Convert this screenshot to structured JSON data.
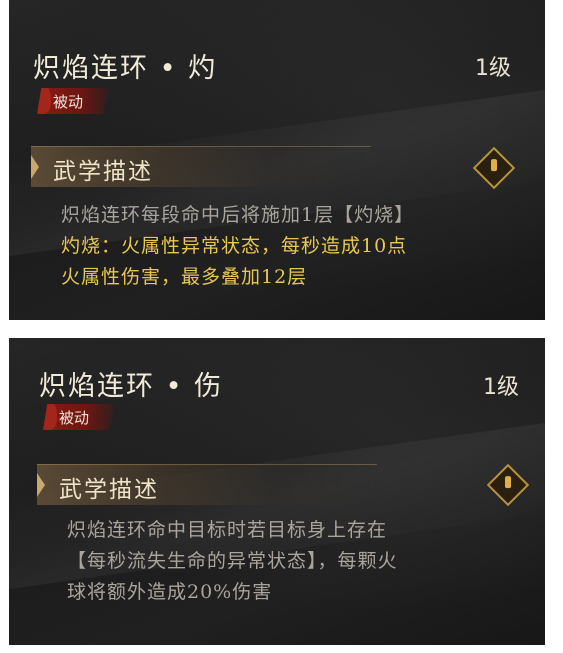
{
  "skills": [
    {
      "name": "炽焰连环 • 灼",
      "level": "1级",
      "tag": "被动",
      "section_title": "武学描述",
      "lines": [
        {
          "text": "炽焰连环每段命中后将施加1层【灼烧】",
          "style": "grey"
        },
        {
          "text": "灼烧：火属性异常状态，每秒造成10点",
          "style": "gold"
        },
        {
          "text": "火属性伤害，最多叠加12层",
          "style": "gold"
        }
      ],
      "icon": "gold-diamond-icon"
    },
    {
      "name": "炽焰连环 • 伤",
      "level": "1级",
      "tag": "被动",
      "section_title": "武学描述",
      "lines": [
        {
          "text": "炽焰连环命中目标时若目标身上存在",
          "style": "grey"
        },
        {
          "text": "【每秒流失生命的异常状态】，每颗火",
          "style": "grey"
        },
        {
          "text": "球将额外造成20%伤害",
          "style": "grey"
        }
      ],
      "icon": "gold-diamond-icon"
    }
  ],
  "colors": {
    "panel_bg": "#1e1e1e",
    "tag_red": "#8a1a12",
    "gold_text": "#e8c652",
    "grey_text": "#a9a49c"
  }
}
